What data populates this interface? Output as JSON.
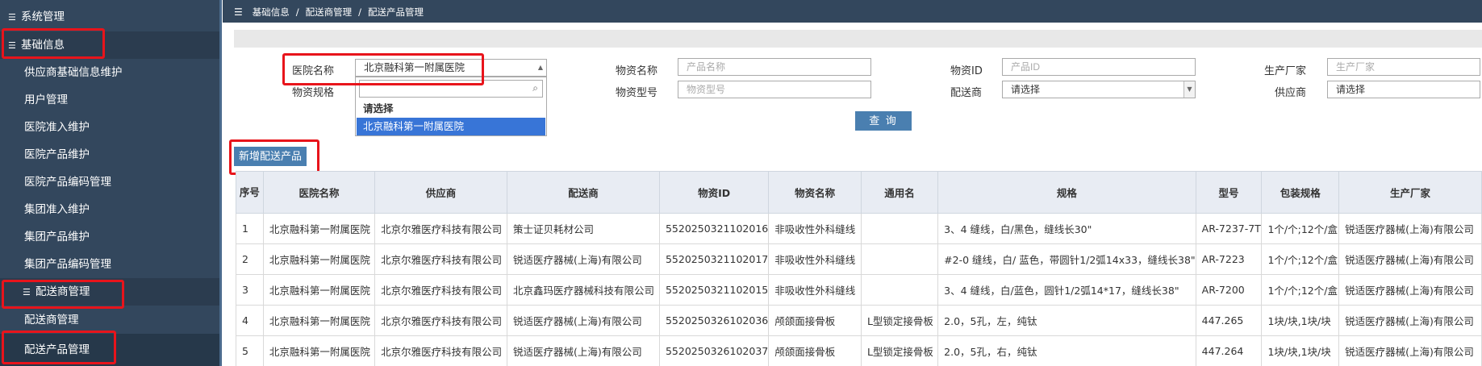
{
  "sidebar": {
    "items": [
      {
        "label": "系统管理",
        "type": "group",
        "icon": "list-icon"
      },
      {
        "label": "基础信息",
        "type": "group",
        "icon": "list-icon",
        "active": true
      },
      {
        "label": "供应商基础信息维护",
        "type": "child"
      },
      {
        "label": "用户管理",
        "type": "child"
      },
      {
        "label": "医院准入维护",
        "type": "child"
      },
      {
        "label": "医院产品维护",
        "type": "child"
      },
      {
        "label": "医院产品编码管理",
        "type": "child"
      },
      {
        "label": "集团准入维护",
        "type": "child"
      },
      {
        "label": "集团产品维护",
        "type": "child"
      },
      {
        "label": "集团产品编码管理",
        "type": "child"
      },
      {
        "label": "配送商管理",
        "type": "child-group",
        "icon": "list-icon",
        "active": true
      },
      {
        "label": "配送商管理",
        "type": "child"
      },
      {
        "label": "配送产品管理",
        "type": "child",
        "active": true
      }
    ]
  },
  "breadcrumb": {
    "items": [
      "基础信息",
      "配送商管理",
      "配送产品管理"
    ],
    "separator": "/"
  },
  "filters": {
    "hospital_label": "医院名称",
    "hospital_value": "北京融科第一附属医院",
    "spec_label": "物资规格",
    "material_name_label": "物资名称",
    "material_name_placeholder": "产品名称",
    "material_model_label": "物资型号",
    "material_model_placeholder": "物资型号",
    "material_id_label": "物资ID",
    "material_id_placeholder": "产品ID",
    "distributor_label": "配送商",
    "distributor_value": "请选择",
    "manufacturer_label": "生产厂家",
    "manufacturer_placeholder": "生产厂家",
    "supplier_label": "供应商",
    "supplier_value": "请选择"
  },
  "dropdown": {
    "options": [
      "请选择",
      "北京融科第一附属医院"
    ],
    "selected_index": 1
  },
  "buttons": {
    "query": "查 询",
    "add": "新增配送产品"
  },
  "table": {
    "headers": [
      "序号",
      "医院名称",
      "供应商",
      "配送商",
      "物资ID",
      "物资名称",
      "通用名",
      "规格",
      "型号",
      "包装规格",
      "生产厂家"
    ],
    "rows": [
      [
        "1",
        "北京融科第一附属医院",
        "北京尔雅医疗科技有限公司",
        "策士证贝耗材公司",
        "5520250321102016",
        "非吸收性外科缝线",
        "",
        "3、4 缝线，白/黑色，缝线长30\"",
        "AR-7237-7T",
        "1个/个;12个/盒",
        "锐适医疗器械(上海)有限公司"
      ],
      [
        "2",
        "北京融科第一附属医院",
        "北京尔雅医疗科技有限公司",
        "锐适医疗器械(上海)有限公司",
        "5520250321102017",
        "非吸收性外科缝线",
        "",
        "#2-0 缝线，白/ 蓝色，带圆针1/2弧14x33，缝线长38\"",
        "AR-7223",
        "1个/个;12个/盒",
        "锐适医疗器械(上海)有限公司"
      ],
      [
        "3",
        "北京融科第一附属医院",
        "北京尔雅医疗科技有限公司",
        "北京鑫玛医疗器械科技有限公司",
        "5520250321102015",
        "非吸收性外科缝线",
        "",
        "3、4 缝线，白/蓝色，圆针1/2弧14*17，缝线长38\"",
        "AR-7200",
        "1个/个;12个/盒",
        "锐适医疗器械(上海)有限公司"
      ],
      [
        "4",
        "北京融科第一附属医院",
        "北京尔雅医疗科技有限公司",
        "锐适医疗器械(上海)有限公司",
        "5520250326102036",
        "颅颌面接骨板",
        "L型锁定接骨板",
        "2.0，5孔，左，纯钛",
        "447.265",
        "1块/块,1块/块",
        "锐适医疗器械(上海)有限公司"
      ],
      [
        "5",
        "北京融科第一附属医院",
        "北京尔雅医疗科技有限公司",
        "锐适医疗器械(上海)有限公司",
        "5520250326102037",
        "颅颌面接骨板",
        "L型锁定接骨板",
        "2.0，5孔，右，纯钛",
        "447.264",
        "1块/块,1块/块",
        "锐适医疗器械(上海)有限公司"
      ]
    ]
  },
  "colors": {
    "sidebar_bg": "#33475d",
    "accent": "#4a7fb0",
    "highlight": "#e8141b",
    "selected_option": "#3875d7"
  }
}
